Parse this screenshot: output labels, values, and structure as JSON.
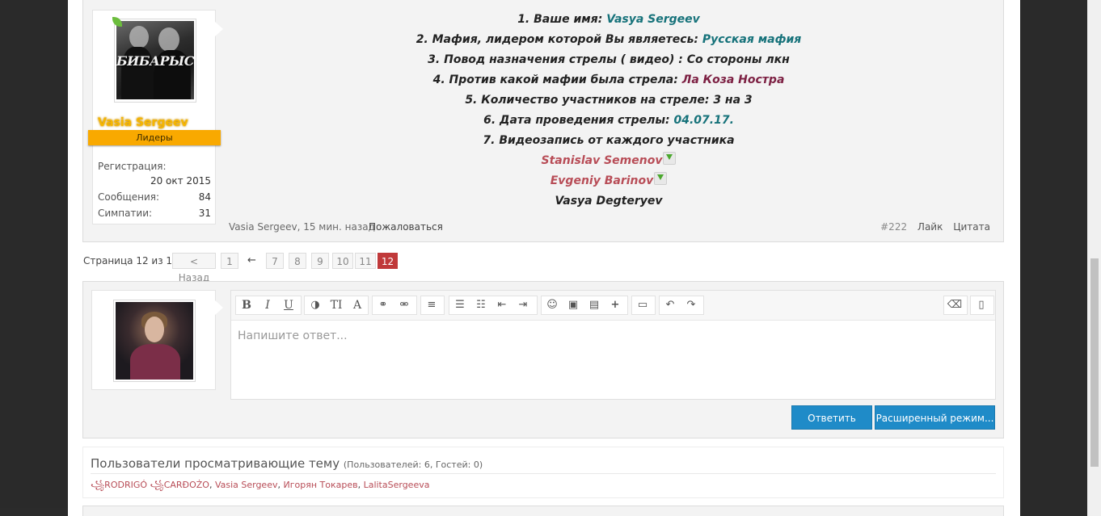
{
  "post": {
    "user": {
      "avatar_caption": "БИБАРЫС",
      "name": "Vasia Sergeev",
      "role": "Лидеры",
      "stats": [
        {
          "label": "Регистрация:",
          "value": "20 окт 2015"
        },
        {
          "label": "Сообщения:",
          "value": "84"
        },
        {
          "label": "Симпатии:",
          "value": "31"
        }
      ]
    },
    "lines": {
      "l1_label": "1. Ваше имя: ",
      "l1_value": "Vasya Sergeev",
      "l2_label": "2. Мафия, лидером которой Вы являетесь: ",
      "l2_value": "Русская мафия",
      "l3": "3. Повод назначения стрелы ( видео) : Со стороны лкн",
      "l4_label": "4. Против какой мафии была стрела: ",
      "l4_value": "Ла Коза Ностра",
      "l5": "5. Количество участников на стреле: 3 на 3",
      "l6_label": "6. Дата проведения стрелы: ",
      "l6_value": "04.07.17.",
      "l7": "7. Видеозапись от каждого участника",
      "p1": "Stanislav Semenov",
      "p2": "Evgeniy Barinov",
      "p3": "Vasya Degteryev"
    },
    "footer": {
      "author_time": "Vasia Sergeev, 15 мин. назад",
      "report": "Пожаловаться",
      "number": "#222",
      "like": "Лайк",
      "quote": "Цитата"
    }
  },
  "pagination": {
    "label": "Страница 12 из 12",
    "prev": "< Назад",
    "first": "1",
    "arrow": "←",
    "pages": [
      "7",
      "8",
      "9",
      "10",
      "11",
      "12"
    ],
    "current": "12"
  },
  "reply": {
    "placeholder": "Напишите ответ...",
    "submit": "Ответить",
    "advanced": "Расширенный режим..."
  },
  "viewers": {
    "title": "Пользователи просматривающие тему",
    "counts": "(Пользователей: 6, Гостей: 0)",
    "u1": "꧁RODRIGÓ ꧁CARĐOŻO",
    "u2": "Vasia Sergeev",
    "u3": "Игорян Токарев",
    "u4": "LalitaSergeeva",
    "sep": ", "
  },
  "colors": {
    "accent_blue": "#1f8bc8",
    "active_page": "#c0393a",
    "banner_gold": "#f9a900",
    "teal_text": "#16727a",
    "maroon_text": "#7c1f42",
    "red_link": "#b84d57"
  }
}
